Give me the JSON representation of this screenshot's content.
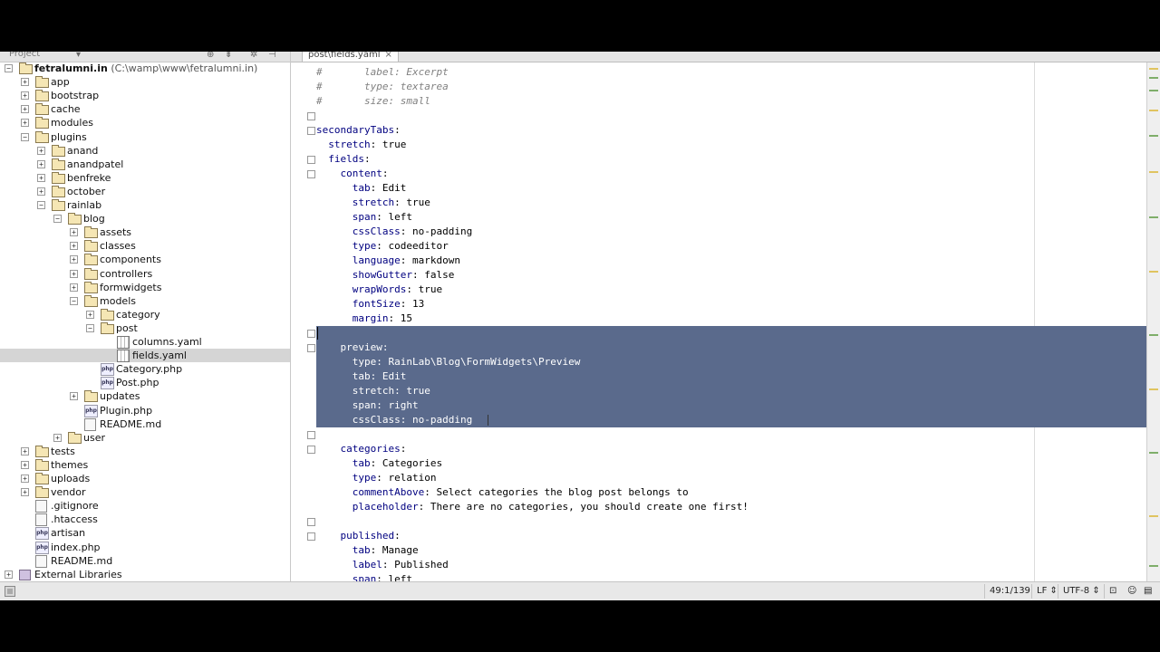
{
  "project_panel": {
    "label": "Project",
    "header_icons": [
      "target-icon",
      "collapse-icon",
      "gear-icon",
      "hide-icon"
    ],
    "tree": [
      {
        "depth": 0,
        "toggle": "-",
        "icon": "folder",
        "name": "fetralumni.in",
        "path": "(C:\\wamp\\www\\fetralumni.in)",
        "bold": true
      },
      {
        "depth": 1,
        "toggle": "+",
        "icon": "folder",
        "name": "app"
      },
      {
        "depth": 1,
        "toggle": "+",
        "icon": "folder",
        "name": "bootstrap"
      },
      {
        "depth": 1,
        "toggle": "+",
        "icon": "folder",
        "name": "cache"
      },
      {
        "depth": 1,
        "toggle": "+",
        "icon": "folder",
        "name": "modules"
      },
      {
        "depth": 1,
        "toggle": "-",
        "icon": "folder",
        "name": "plugins"
      },
      {
        "depth": 2,
        "toggle": "+",
        "icon": "folder",
        "name": "anand"
      },
      {
        "depth": 2,
        "toggle": "+",
        "icon": "folder",
        "name": "anandpatel"
      },
      {
        "depth": 2,
        "toggle": "+",
        "icon": "folder",
        "name": "benfreke"
      },
      {
        "depth": 2,
        "toggle": "+",
        "icon": "folder",
        "name": "october"
      },
      {
        "depth": 2,
        "toggle": "-",
        "icon": "folder",
        "name": "rainlab"
      },
      {
        "depth": 3,
        "toggle": "-",
        "icon": "folder",
        "name": "blog"
      },
      {
        "depth": 4,
        "toggle": "+",
        "icon": "folder",
        "name": "assets"
      },
      {
        "depth": 4,
        "toggle": "+",
        "icon": "folder",
        "name": "classes"
      },
      {
        "depth": 4,
        "toggle": "+",
        "icon": "folder",
        "name": "components"
      },
      {
        "depth": 4,
        "toggle": "+",
        "icon": "folder",
        "name": "controllers"
      },
      {
        "depth": 4,
        "toggle": "+",
        "icon": "folder",
        "name": "formwidgets"
      },
      {
        "depth": 4,
        "toggle": "-",
        "icon": "folder",
        "name": "models"
      },
      {
        "depth": 5,
        "toggle": "+",
        "icon": "folder",
        "name": "category"
      },
      {
        "depth": 5,
        "toggle": "-",
        "icon": "folder",
        "name": "post"
      },
      {
        "depth": 6,
        "toggle": "",
        "icon": "yaml",
        "name": "columns.yaml"
      },
      {
        "depth": 6,
        "toggle": "",
        "icon": "yaml",
        "name": "fields.yaml",
        "selected": true
      },
      {
        "depth": 5,
        "toggle": "",
        "icon": "php",
        "name": "Category.php"
      },
      {
        "depth": 5,
        "toggle": "",
        "icon": "php",
        "name": "Post.php"
      },
      {
        "depth": 4,
        "toggle": "+",
        "icon": "folder",
        "name": "updates"
      },
      {
        "depth": 4,
        "toggle": "",
        "icon": "php",
        "name": "Plugin.php"
      },
      {
        "depth": 4,
        "toggle": "",
        "icon": "file",
        "name": "README.md"
      },
      {
        "depth": 3,
        "toggle": "+",
        "icon": "folder",
        "name": "user"
      },
      {
        "depth": 1,
        "toggle": "+",
        "icon": "folder",
        "name": "tests"
      },
      {
        "depth": 1,
        "toggle": "+",
        "icon": "folder",
        "name": "themes"
      },
      {
        "depth": 1,
        "toggle": "+",
        "icon": "folder",
        "name": "uploads"
      },
      {
        "depth": 1,
        "toggle": "+",
        "icon": "folder",
        "name": "vendor"
      },
      {
        "depth": 1,
        "toggle": "",
        "icon": "file",
        "name": ".gitignore"
      },
      {
        "depth": 1,
        "toggle": "",
        "icon": "file",
        "name": ".htaccess"
      },
      {
        "depth": 1,
        "toggle": "",
        "icon": "php",
        "name": "artisan"
      },
      {
        "depth": 1,
        "toggle": "",
        "icon": "php",
        "name": "index.php"
      },
      {
        "depth": 1,
        "toggle": "",
        "icon": "file",
        "name": "README.md"
      },
      {
        "depth": 0,
        "toggle": "+",
        "icon": "lib",
        "name": "External Libraries"
      }
    ]
  },
  "editor": {
    "tab": {
      "label": "post\\fields.yaml",
      "close": "×"
    },
    "lines": [
      {
        "indent": "",
        "comment": "#       label: Excerpt"
      },
      {
        "indent": "",
        "comment": "#       type: textarea"
      },
      {
        "indent": "",
        "comment": "#       size: small"
      },
      {
        "indent": "",
        "key": "",
        "val": ""
      },
      {
        "indent": "",
        "key": "secondaryTabs",
        "val": ":"
      },
      {
        "indent": "  ",
        "key": "stretch",
        "val": ": true"
      },
      {
        "indent": "  ",
        "key": "fields",
        "val": ":"
      },
      {
        "indent": "    ",
        "key": "content",
        "val": ":"
      },
      {
        "indent": "      ",
        "key": "tab",
        "val": ": Edit"
      },
      {
        "indent": "      ",
        "key": "stretch",
        "val": ": true"
      },
      {
        "indent": "      ",
        "key": "span",
        "val": ": left"
      },
      {
        "indent": "      ",
        "key": "cssClass",
        "val": ": no-padding"
      },
      {
        "indent": "      ",
        "key": "type",
        "val": ": codeeditor"
      },
      {
        "indent": "      ",
        "key": "language",
        "val": ": markdown"
      },
      {
        "indent": "      ",
        "key": "showGutter",
        "val": ": false"
      },
      {
        "indent": "      ",
        "key": "wrapWords",
        "val": ": true"
      },
      {
        "indent": "      ",
        "key": "fontSize",
        "val": ": 13"
      },
      {
        "indent": "      ",
        "key": "margin",
        "val": ": 15"
      },
      {
        "indent": "",
        "key": "",
        "val": "",
        "selected": true
      },
      {
        "indent": "    ",
        "key": "preview",
        "val": ":",
        "selected": true
      },
      {
        "indent": "      ",
        "key": "type",
        "val": ": RainLab\\Blog\\FormWidgets\\Preview",
        "selected": true
      },
      {
        "indent": "      ",
        "key": "tab",
        "val": ": Edit",
        "selected": true
      },
      {
        "indent": "      ",
        "key": "stretch",
        "val": ": true",
        "selected": true
      },
      {
        "indent": "      ",
        "key": "span",
        "val": ": right",
        "selected": true
      },
      {
        "indent": "      ",
        "key": "cssClass",
        "val": ": no-padding",
        "selected": true
      },
      {
        "indent": "",
        "key": "",
        "val": ""
      },
      {
        "indent": "    ",
        "key": "categories",
        "val": ":"
      },
      {
        "indent": "      ",
        "key": "tab",
        "val": ": Categories"
      },
      {
        "indent": "      ",
        "key": "type",
        "val": ": relation"
      },
      {
        "indent": "      ",
        "key": "commentAbove",
        "val": ": Select categories the blog post belongs to"
      },
      {
        "indent": "      ",
        "key": "placeholder",
        "val": ": There are no categories, you should create one first!"
      },
      {
        "indent": "",
        "key": "",
        "val": ""
      },
      {
        "indent": "    ",
        "key": "published",
        "val": ":"
      },
      {
        "indent": "      ",
        "key": "tab",
        "val": ": Manage"
      },
      {
        "indent": "      ",
        "key": "label",
        "val": ": Published"
      },
      {
        "indent": "      ",
        "key": "span",
        "val": ": left"
      }
    ],
    "selection_color": "#5a6a8c"
  },
  "status_bar": {
    "position": "49:1/139",
    "line_separator": "LF",
    "encoding": "UTF-8",
    "icons": [
      "lock-icon",
      "inspector-icon",
      "memory-icon"
    ]
  }
}
